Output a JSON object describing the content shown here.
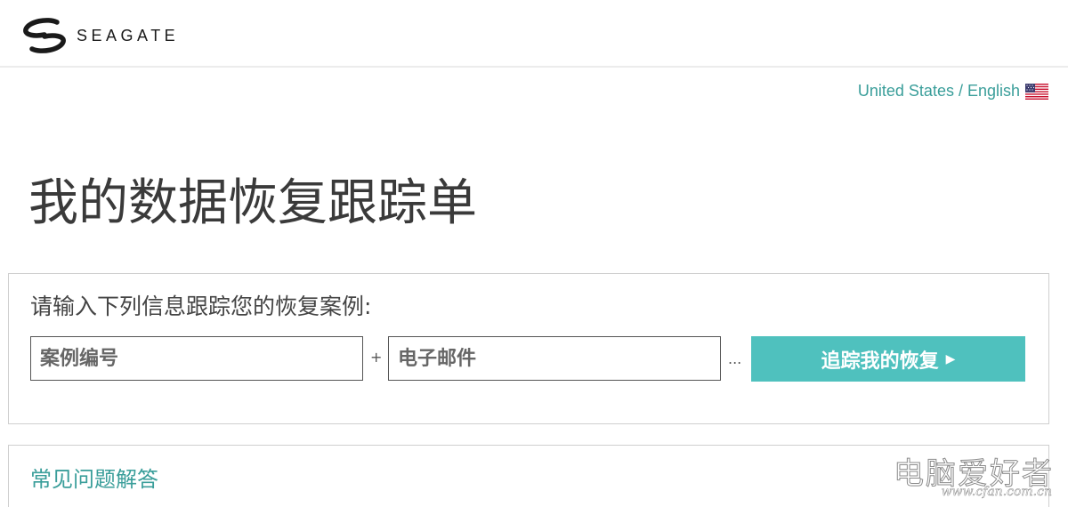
{
  "header": {
    "brand_name": "SEAGATE"
  },
  "locale": {
    "label": "United States / English",
    "flag_icon": "us-flag-icon"
  },
  "page": {
    "title": "我的数据恢复跟踪单"
  },
  "tracking": {
    "prompt": "请输入下列信息跟踪您的恢复案例:",
    "case_number_placeholder": "案例编号",
    "case_number_value": "",
    "email_placeholder": "电子邮件",
    "email_value": "",
    "plus_separator": "+",
    "dots_separator": "...",
    "submit_label": "追踪我的恢复",
    "submit_icon": "chevron-right-icon",
    "button_color": "#4fc1be"
  },
  "faq": {
    "label": "常见问题解答"
  },
  "watermark": {
    "text": "电脑爱好者",
    "url": "www.cfan.com.cn"
  },
  "colors": {
    "accent_link": "#3a9e9a",
    "button": "#4fc1be",
    "border": "#cfcfcf"
  }
}
